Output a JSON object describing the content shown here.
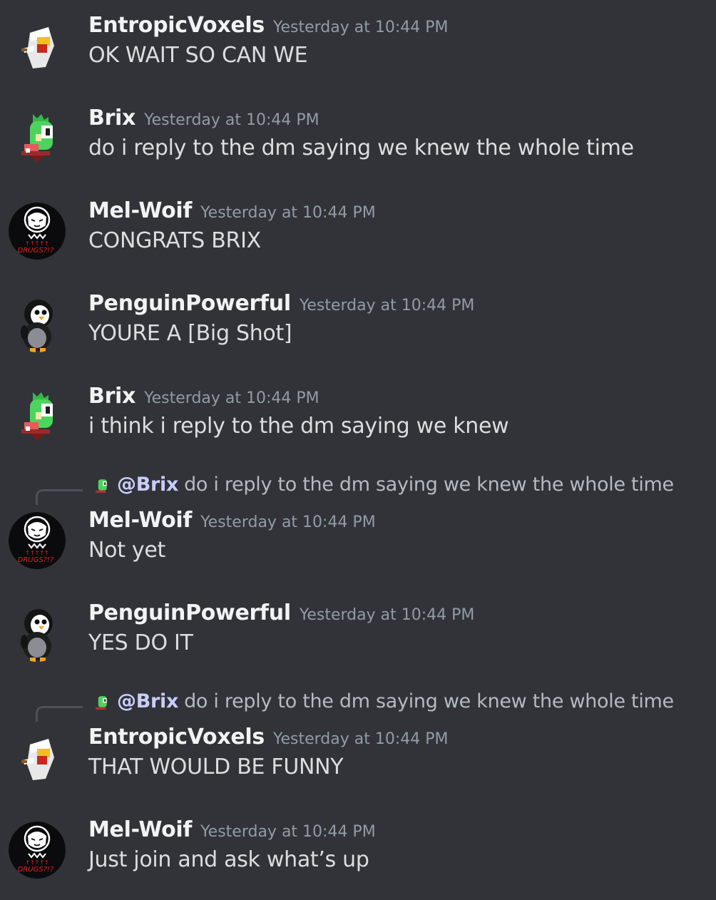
{
  "colors": {
    "background": "#313338",
    "username": "#f2f3f5",
    "timestamp": "#949ba4",
    "message_text": "#dbdee1",
    "reply_mention": "#c9cdfb"
  },
  "messages": [
    {
      "author": "EntropicVoxels",
      "avatar_icon": "chicken-avatar-icon",
      "timestamp": "Yesterday at 10:44 PM",
      "text": "OK WAIT SO CAN WE"
    },
    {
      "author": "Brix",
      "avatar_icon": "green-dragon-avatar-icon",
      "timestamp": "Yesterday at 10:44 PM",
      "text": "do i reply to the dm saying we knew the whole time"
    },
    {
      "author": "Mel-Woif",
      "avatar_icon": "wolf-drugs-avatar-icon",
      "avatar_text": "DRUGS?!?",
      "timestamp": "Yesterday at 10:44 PM",
      "text": "CONGRATS BRIX"
    },
    {
      "author": "PenguinPowerful",
      "avatar_icon": "penguin-avatar-icon",
      "timestamp": "Yesterday at 10:44 PM",
      "text": "YOURE A [Big Shot]"
    },
    {
      "author": "Brix",
      "avatar_icon": "green-dragon-avatar-icon",
      "timestamp": "Yesterday at 10:44 PM",
      "text": "i think i reply to the dm saying we knew"
    },
    {
      "reply": {
        "mention": "@Brix",
        "snippet": "do i reply to the dm saying we knew the whole time",
        "avatar_icon": "green-dragon-avatar-icon"
      },
      "author": "Mel-Woif",
      "avatar_icon": "wolf-drugs-avatar-icon",
      "avatar_text": "DRUGS?!?",
      "timestamp": "Yesterday at 10:44 PM",
      "text": "Not yet"
    },
    {
      "author": "PenguinPowerful",
      "avatar_icon": "penguin-avatar-icon",
      "timestamp": "Yesterday at 10:44 PM",
      "text": "YES DO IT"
    },
    {
      "reply": {
        "mention": "@Brix",
        "snippet": "do i reply to the dm saying we knew the whole time",
        "avatar_icon": "green-dragon-avatar-icon"
      },
      "author": "EntropicVoxels",
      "avatar_icon": "chicken-avatar-icon",
      "timestamp": "Yesterday at 10:44 PM",
      "text": "THAT WOULD BE FUNNY"
    },
    {
      "author": "Mel-Woif",
      "avatar_icon": "wolf-drugs-avatar-icon",
      "avatar_text": "DRUGS?!?",
      "timestamp": "Yesterday at 10:44 PM",
      "text": "Just join and ask what’s up"
    }
  ]
}
